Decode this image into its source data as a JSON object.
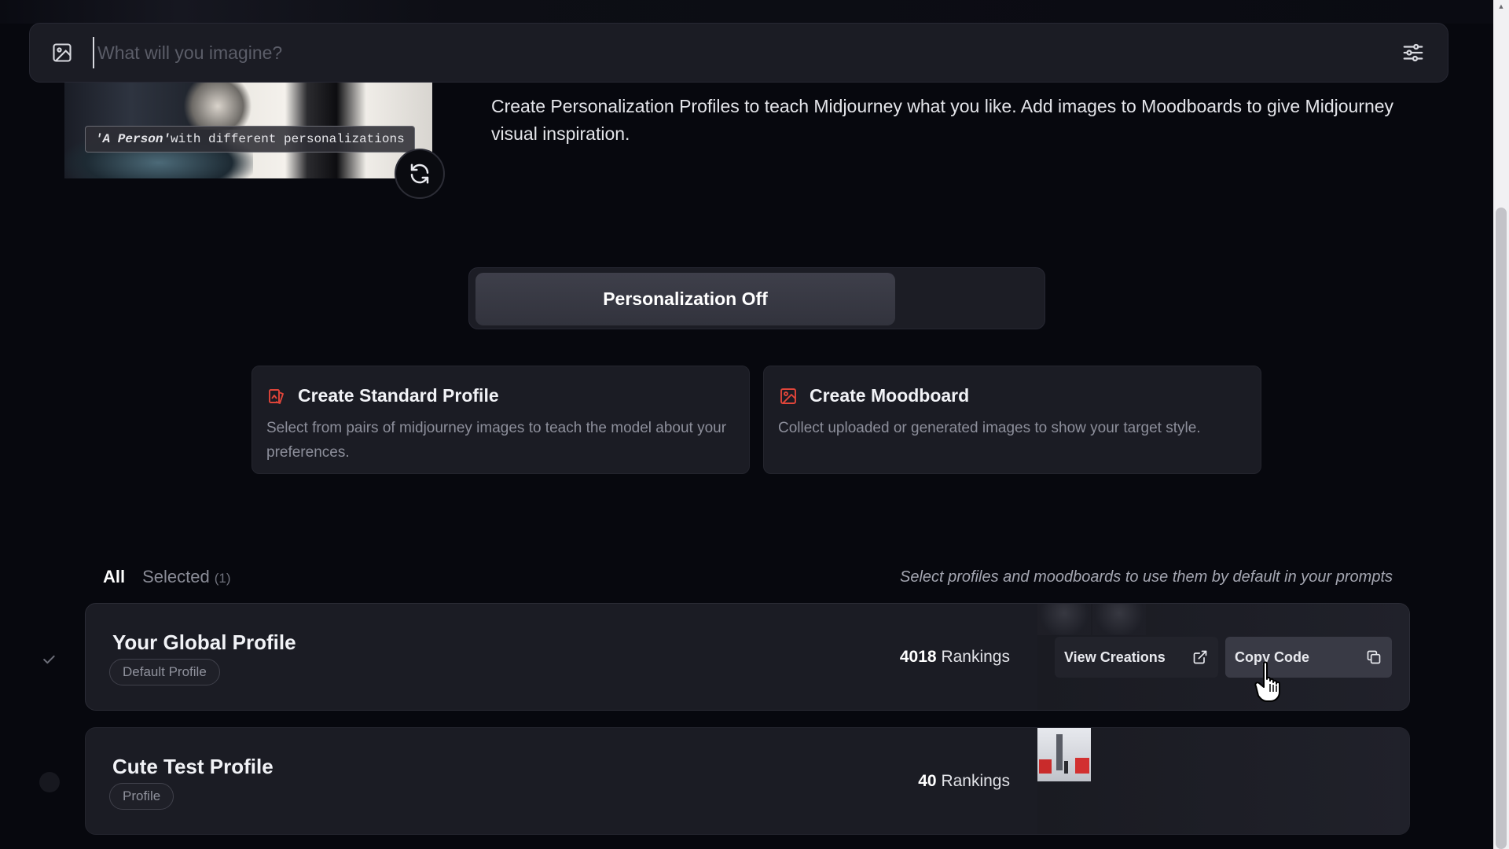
{
  "search": {
    "placeholder": "What will you imagine?"
  },
  "hero": {
    "caption_quoted": "'A Person'",
    "caption_rest": " with different personalizations",
    "intro": "Create Personalization Profiles to teach Midjourney what you like. Add images to Moodboards to give Midjourney visual inspiration."
  },
  "toggle": {
    "label": "Personalization Off",
    "state": "off"
  },
  "cards": {
    "standard": {
      "title": "Create Standard Profile",
      "description": "Select from pairs of midjourney images to teach the model about your preferences.",
      "icon": "profile-card-icon",
      "accent": "#e0453a"
    },
    "moodboard": {
      "title": "Create Moodboard",
      "description": "Collect uploaded or generated images to show your target style.",
      "icon": "moodboard-image-icon",
      "accent": "#e0453a"
    }
  },
  "filters": {
    "all_label": "All",
    "selected_label": "Selected",
    "selected_count": "(1)",
    "active": "All",
    "hint": "Select profiles and moodboards to use them by default in your prompts"
  },
  "profiles": [
    {
      "name": "Your Global Profile",
      "tag": "Default Profile",
      "rankings_count": "4018",
      "rankings_label": "Rankings",
      "selected": true,
      "view_label": "View Creations",
      "copy_label": "Copy Code"
    },
    {
      "name": "Cute Test Profile",
      "tag": "Profile",
      "rankings_count": "40",
      "rankings_label": "Rankings",
      "selected": false
    }
  ],
  "icons": {
    "search_left": "image-icon",
    "search_right": "sliders-icon",
    "refresh": "refresh-icon",
    "view": "external-link-icon",
    "copy": "copy-icon",
    "check": "check-icon"
  }
}
